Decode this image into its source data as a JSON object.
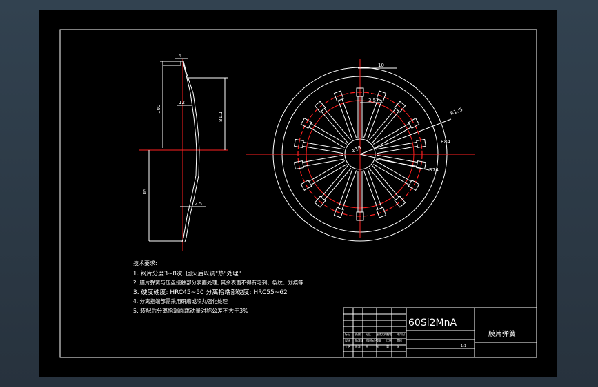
{
  "drawing": {
    "tech_requirements": {
      "heading": "技术要求:",
      "lines": [
        "1. 钢片分度3~8次, 回火后以调\"热\"处理\"",
        "2. 膜片弹簧与压盘接触部分表面处理, 其余表面不得有毛刺、裂纹、划痕等.",
        "3. 硬度硬度: HRC45~50    分离指端部硬度: HRC55~62",
        "4. 分离指端部需采用研磨或喷丸强化处理",
        "5. 装配后分离指端面跳动量对称公差不大于3%"
      ]
    },
    "dimensions": {
      "thickness_top": "4",
      "thickness_mid": "12",
      "height_100": "100",
      "height_81": "81.1",
      "height_105": "105",
      "thickness_bottom": "2.5",
      "slot_width": "10",
      "finger_gap": "3.5",
      "radius_105": "R105",
      "radius_84": "R84",
      "radius_74": "R74",
      "inner_dia": "Φ18"
    },
    "title_block": {
      "material": "60Si2MnA",
      "part_name": "膜片弹簧",
      "scale": "1:1",
      "cells": [
        "标记",
        "处数",
        "分区",
        "更改文件号",
        "签名",
        "年月日",
        "设计",
        "标准化",
        "阶段标记",
        "重量",
        "比例",
        "审核",
        "工艺",
        "批准",
        "共",
        "张",
        "第",
        "张"
      ]
    },
    "colors": {
      "background": "#000000",
      "line": "#ffffff",
      "centerline": "#ff1f1f"
    }
  }
}
